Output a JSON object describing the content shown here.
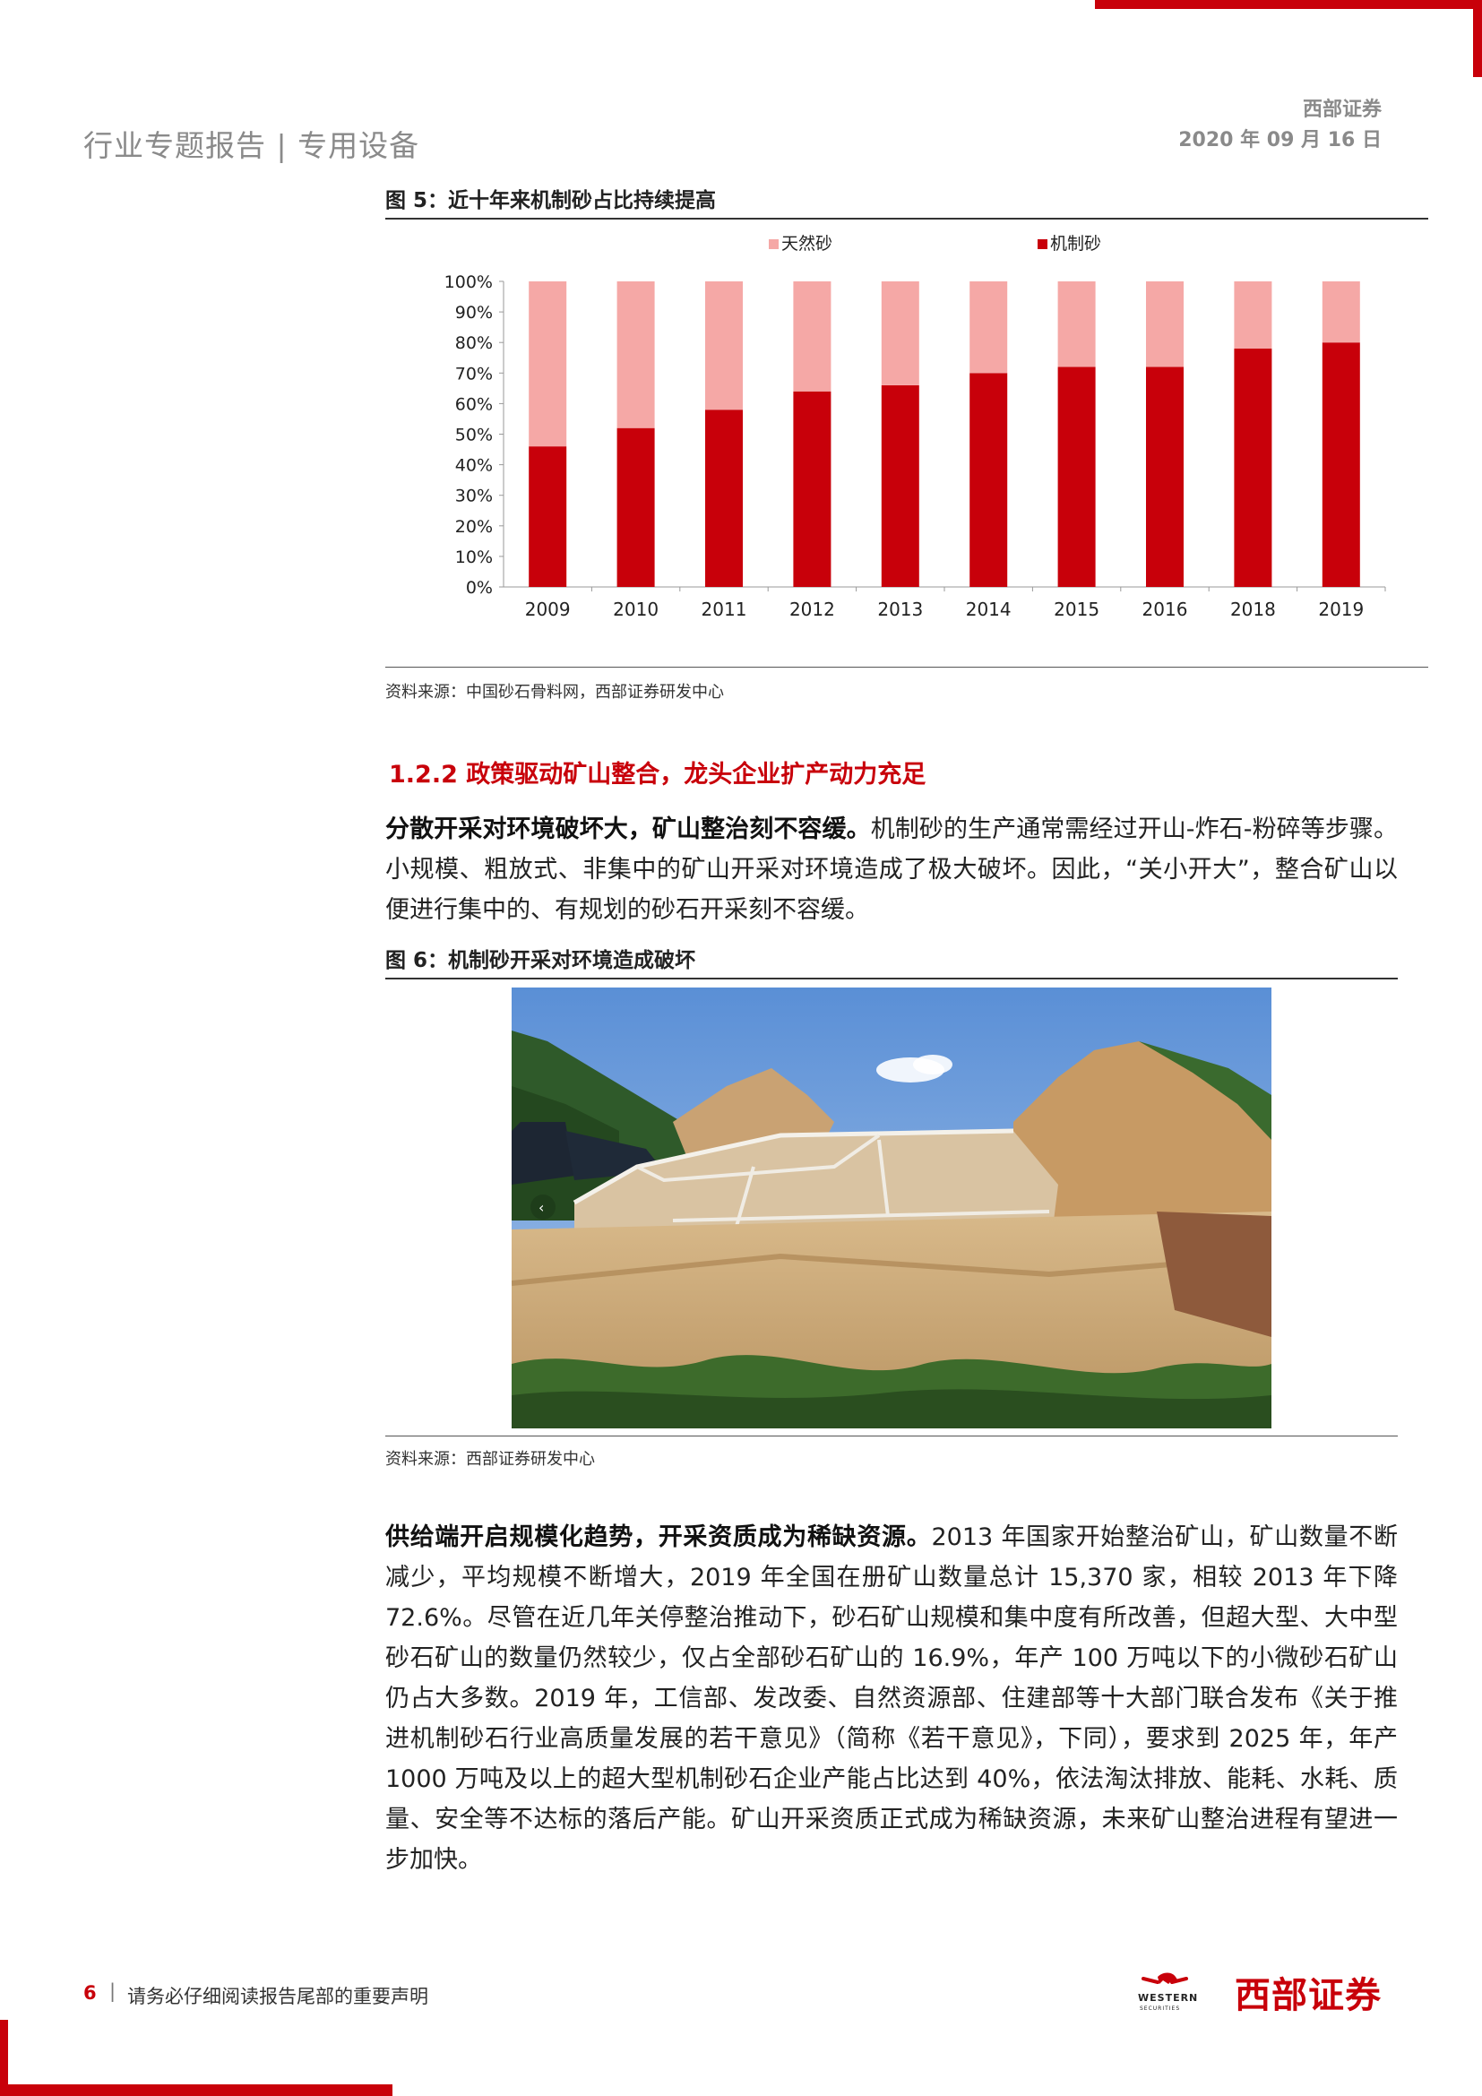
{
  "header": {
    "title": "行业专题报告 | 专用设备",
    "company": "西部证券",
    "date": "2020 年 09 月 16 日"
  },
  "figure5": {
    "title": "图 5：近十年来机制砂占比持续提高",
    "source": "资料来源：中国砂石骨料网，西部证券研发中心"
  },
  "chart_data": {
    "type": "bar",
    "stacked": true,
    "categories": [
      "2009",
      "2010",
      "2011",
      "2012",
      "2013",
      "2014",
      "2015",
      "2016",
      "2018",
      "2019"
    ],
    "series": [
      {
        "name": "机制砂",
        "values": [
          46,
          52,
          58,
          64,
          66,
          70,
          72,
          72,
          78,
          80
        ],
        "color": "#c8000a"
      },
      {
        "name": "天然砂",
        "values": [
          54,
          48,
          42,
          36,
          34,
          30,
          28,
          28,
          22,
          20
        ],
        "color": "#f5a8a6"
      }
    ],
    "y_ticks": [
      "0%",
      "10%",
      "20%",
      "30%",
      "40%",
      "50%",
      "60%",
      "70%",
      "80%",
      "90%",
      "100%"
    ],
    "ylim": [
      0,
      100
    ],
    "legend": [
      "天然砂",
      "机制砂"
    ],
    "legend_position": "top",
    "grid": false
  },
  "section": {
    "heading": "1.2.2 政策驱动矿山整合，龙头企业扩产动力充足"
  },
  "para1": {
    "lead": "分散开采对环境破坏大，矿山整治刻不容缓。",
    "body": "机制砂的生产通常需经过开山-炸石-粉碎等步骤。小规模、粗放式、非集中的矿山开采对环境造成了极大破坏。因此，“关小开大”，整合矿山以便进行集中的、有规划的砂石开采刻不容缓。"
  },
  "figure6": {
    "title": "图 6：机制砂开采对环境造成破坏",
    "source": "资料来源：西部证券研发中心"
  },
  "para2": {
    "lead": "供给端开启规模化趋势，开采资质成为稀缺资源。",
    "body": "2013 年国家开始整治矿山，矿山数量不断减少，平均规模不断增大，2019 年全国在册矿山数量总计 15,370 家，相较 2013 年下降 72.6%。尽管在近几年关停整治推动下，砂石矿山规模和集中度有所改善，但超大型、大中型砂石矿山的数量仍然较少，仅占全部砂石矿山的 16.9%，年产 100 万吨以下的小微砂石矿山仍占大多数。2019 年，工信部、发改委、自然资源部、住建部等十大部门联合发布《关于推进机制砂石行业高质量发展的若干意见》（简称《若干意见》，下同），要求到 2025 年，年产 1000 万吨及以上的超大型机制砂石企业产能占比达到 40%，依法淘汰排放、能耗、水耗、质量、安全等不达标的落后产能。矿山开采资质正式成为稀缺资源，未来矿山整治进程有望进一步加快。"
  },
  "footer": {
    "page": "6",
    "notice": "请务必仔细阅读报告尾部的重要声明",
    "logo_cn": "西部证券",
    "logo_en": "WESTERN",
    "logo_sub": "SECURITIES"
  }
}
